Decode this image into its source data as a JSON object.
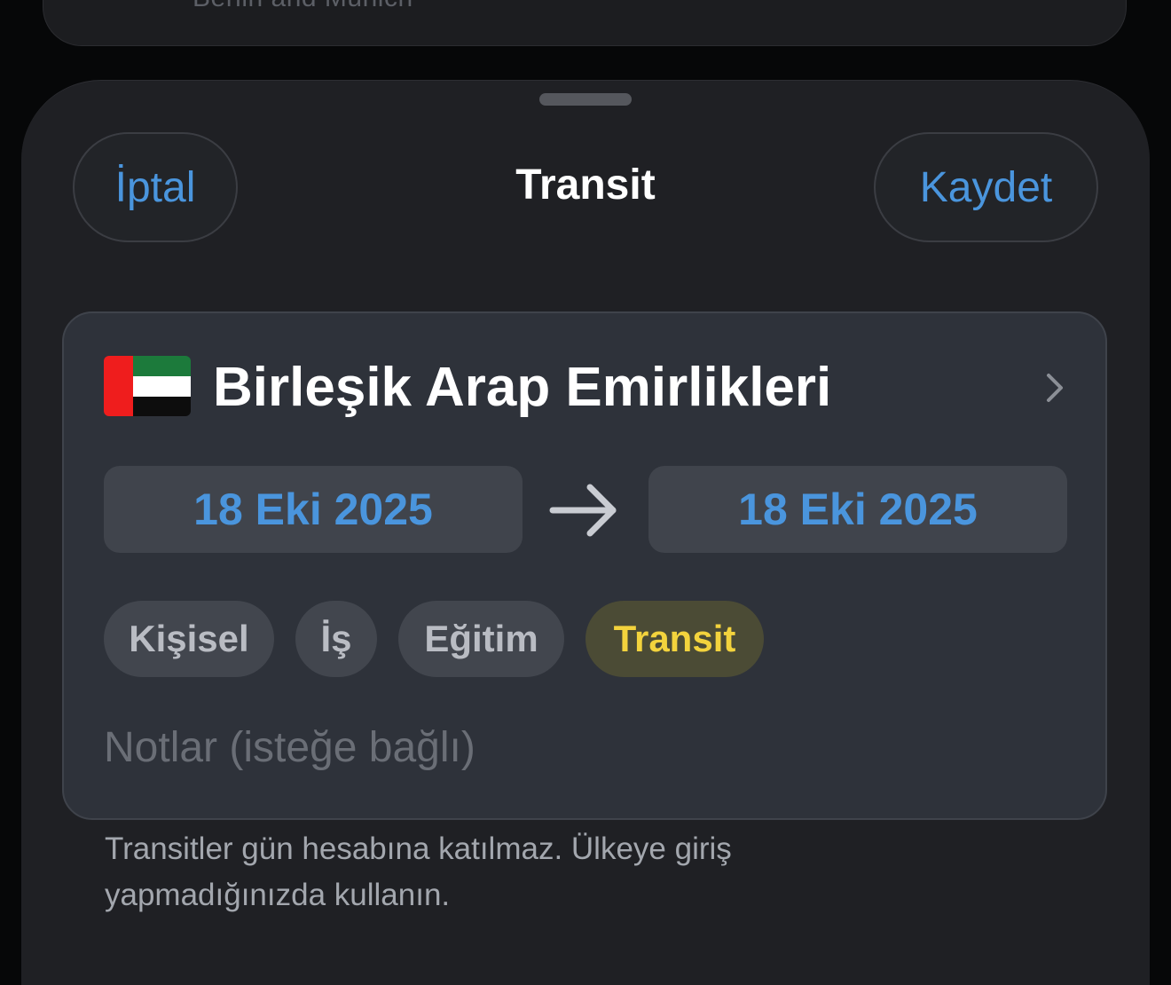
{
  "background_card": {
    "text": "Berlin and Munich"
  },
  "header": {
    "cancel_label": "İptal",
    "title": "Transit",
    "save_label": "Kaydet"
  },
  "country": {
    "name": "Birleşik Arap Emirlikleri",
    "flag_icon": "uae-flag-icon",
    "flag_colors": {
      "red": "#ef1d1d",
      "green": "#1c7a3b",
      "white": "#ffffff",
      "black": "#0d0d0d"
    }
  },
  "dates": {
    "start": "18 Eki 2025",
    "end": "18 Eki 2025",
    "separator_icon": "arrow-right-icon"
  },
  "categories": [
    {
      "label": "Kişisel",
      "selected": false
    },
    {
      "label": "İş",
      "selected": false
    },
    {
      "label": "Eğitim",
      "selected": false
    },
    {
      "label": "Transit",
      "selected": true
    }
  ],
  "notes": {
    "placeholder": "Notlar (isteğe bağlı)"
  },
  "footnote": "Transitler gün hesabına katılmaz. Ülkeye giriş yapmadığınızda kullanın.",
  "colors": {
    "accent": "#4a95dd",
    "selected_chip_text": "#f3d33d",
    "selected_chip_bg": "#4b4b35",
    "card_bg": "#2e323a",
    "sheet_bg": "#1f2024"
  }
}
